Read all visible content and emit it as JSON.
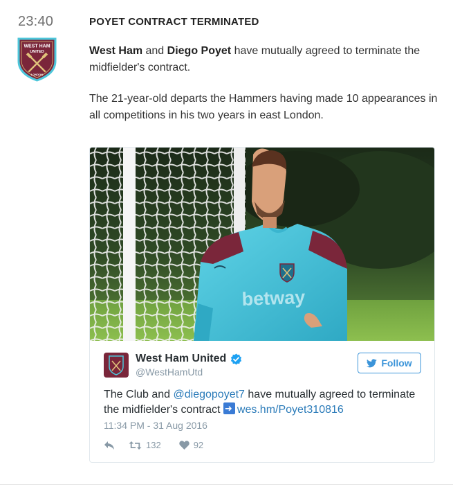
{
  "entry": {
    "time": "23:40",
    "crest_alt": "West Ham United crest",
    "title": "POYET CONTRACT TERMINATED",
    "para1_bold1": "West Ham",
    "para1_text1": " and ",
    "para1_bold2": "Diego Poyet",
    "para1_text2": " have mutually agreed to terminate the midfielder's contract.",
    "para2": "The 21-year-old departs the Hammers having made 10 appearances in all competitions in his two years in east London."
  },
  "tweet": {
    "author_name": "West Ham United",
    "handle": "@WestHamUtd",
    "follow_label": "Follow",
    "text_1": "The Club and ",
    "mention": "@diegopoyet7",
    "text_2": " have mutually agreed to terminate the midfielder's contract ",
    "link": "wes.hm/Poyet310816",
    "timestamp": "11:34 PM - 31 Aug 2016",
    "retweets": "132",
    "likes": "92",
    "photo_shirt_text": "betway"
  },
  "crest": {
    "line1": "WEST HAM",
    "line2": "UNITED",
    "line3": "LONDON"
  },
  "colors": {
    "claret": "#7a263a",
    "sky_blue": "#4dc6da",
    "twitter_blue": "#3b94d9",
    "link_blue": "#2b7bb9",
    "muted_gray": "#8899a6"
  },
  "icons": {
    "crest": "west-ham-crest-icon",
    "verified": "verified-badge-icon",
    "follow": "twitter-bird-icon",
    "reply": "reply-icon",
    "retweet": "retweet-icon",
    "like": "heart-icon",
    "link_arrow": "right-arrow-emoji-icon"
  }
}
